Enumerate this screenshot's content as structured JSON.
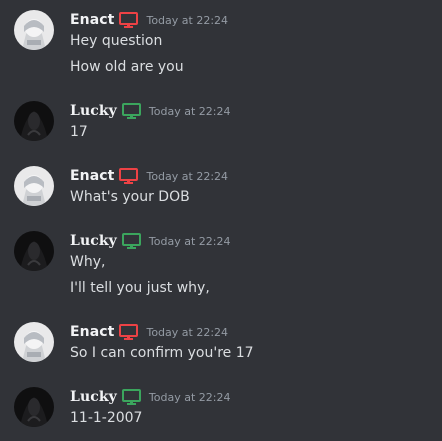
{
  "colors": {
    "background": "#313338",
    "desktop_red": "#ed4245",
    "desktop_green": "#3ba55d",
    "timestamp": "#949ba4"
  },
  "messages": [
    {
      "username": "Enact",
      "status_icon": "desktop-icon",
      "status_color": "red",
      "timestamp": "Today at 22:24",
      "lines": [
        "Hey question",
        "How old are you"
      ]
    },
    {
      "username": "Lucky",
      "status_icon": "desktop-icon",
      "status_color": "green",
      "timestamp": "Today at 22:24",
      "lines": [
        "17"
      ]
    },
    {
      "username": "Enact",
      "status_icon": "desktop-icon",
      "status_color": "red",
      "timestamp": "Today at 22:24",
      "lines": [
        "What's your DOB"
      ]
    },
    {
      "username": "Lucky",
      "status_icon": "desktop-icon",
      "status_color": "green",
      "timestamp": "Today at 22:24",
      "lines": [
        "Why,",
        "I'll tell you just why,"
      ]
    },
    {
      "username": "Enact",
      "status_icon": "desktop-icon",
      "status_color": "red",
      "timestamp": "Today at 22:24",
      "lines": [
        "So I can confirm you're 17"
      ]
    },
    {
      "username": "Lucky",
      "status_icon": "desktop-icon",
      "status_color": "green",
      "timestamp": "Today at 22:24",
      "lines": [
        "11-1-2007"
      ]
    }
  ]
}
